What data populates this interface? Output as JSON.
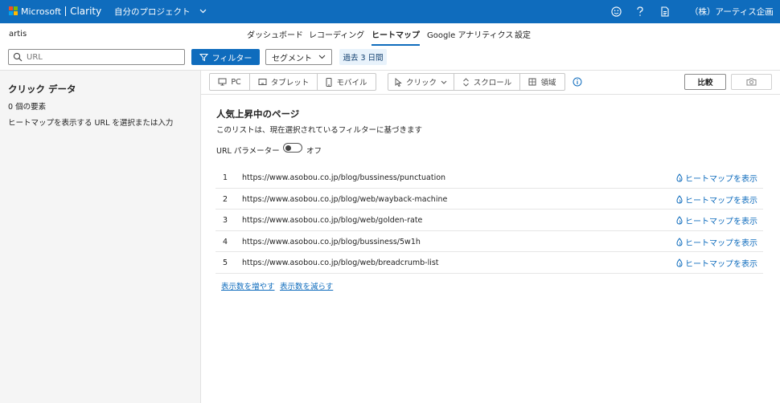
{
  "header": {
    "brand_ms": "Microsoft",
    "brand_app": "Clarity",
    "project_selector": "自分のプロジェクト",
    "company": "（株）アーティス企画",
    "colors": {
      "bar": "#0f6cbd",
      "logo": [
        "#f25022",
        "#7fba00",
        "#00a4ef",
        "#ffb900"
      ]
    },
    "icons": [
      "smiley-icon",
      "help-icon",
      "document-icon",
      "chevron-down-icon"
    ]
  },
  "project_name": "artis",
  "nav": {
    "tabs": [
      {
        "label": "ダッシュボード"
      },
      {
        "label": "レコーディング"
      },
      {
        "label": "ヒートマップ",
        "active": true
      },
      {
        "label": "Google アナリティクス"
      },
      {
        "label": "設定"
      }
    ]
  },
  "filters": {
    "url_placeholder": "URL",
    "filter_button": "フィルター",
    "segment_button": "セグメント",
    "date_range": "過去 3 日間"
  },
  "sidebar": {
    "title": "クリック データ",
    "count": "0 個の要素",
    "hint": "ヒートマップを表示する URL を選択または入力"
  },
  "toolbar": {
    "devices": [
      "PC",
      "タブレット",
      "モバイル"
    ],
    "modes": [
      "クリック",
      "スクロール",
      "領域"
    ],
    "compare": "比較"
  },
  "content": {
    "title": "人気上昇中のページ",
    "subtitle": "このリストは、現在選択されているフィルターに基づきます",
    "url_param_label": "URL パラメーター",
    "url_param_state": "オフ",
    "view_label": "ヒートマップを表示",
    "rows": [
      {
        "num": "1",
        "url": "https://www.asobou.co.jp/blog/bussiness/punctuation"
      },
      {
        "num": "2",
        "url": "https://www.asobou.co.jp/blog/web/wayback-machine"
      },
      {
        "num": "3",
        "url": "https://www.asobou.co.jp/blog/web/golden-rate"
      },
      {
        "num": "4",
        "url": "https://www.asobou.co.jp/blog/bussiness/5w1h"
      },
      {
        "num": "5",
        "url": "https://www.asobou.co.jp/blog/web/breadcrumb-list"
      }
    ],
    "show_more": "表示数を増やす",
    "show_less": "表示数を減らす"
  }
}
